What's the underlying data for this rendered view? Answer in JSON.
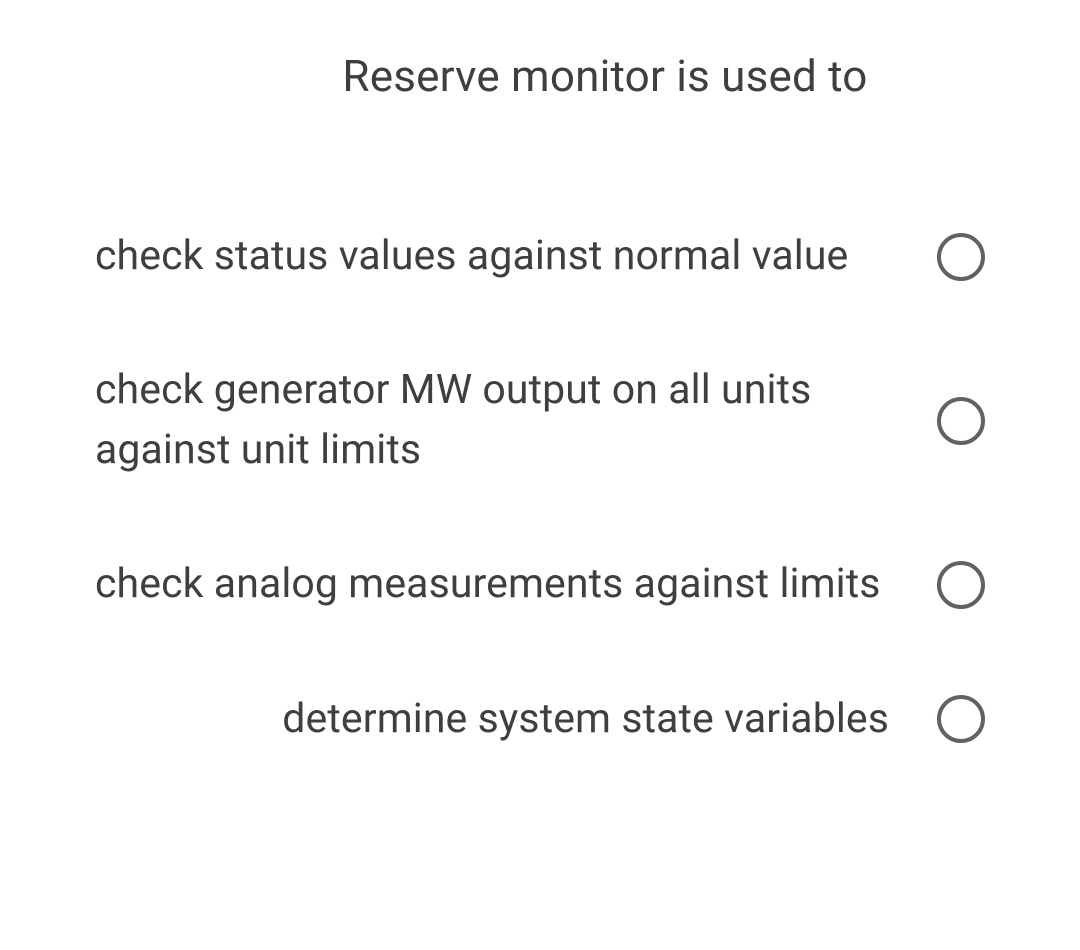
{
  "question": {
    "title": "Reserve monitor is used to",
    "options": [
      {
        "label": "check status values against normal value"
      },
      {
        "label": "check generator MW output on all units against unit limits"
      },
      {
        "label": "check analog measurements against limits"
      },
      {
        "label": "determine system state variables"
      }
    ]
  }
}
